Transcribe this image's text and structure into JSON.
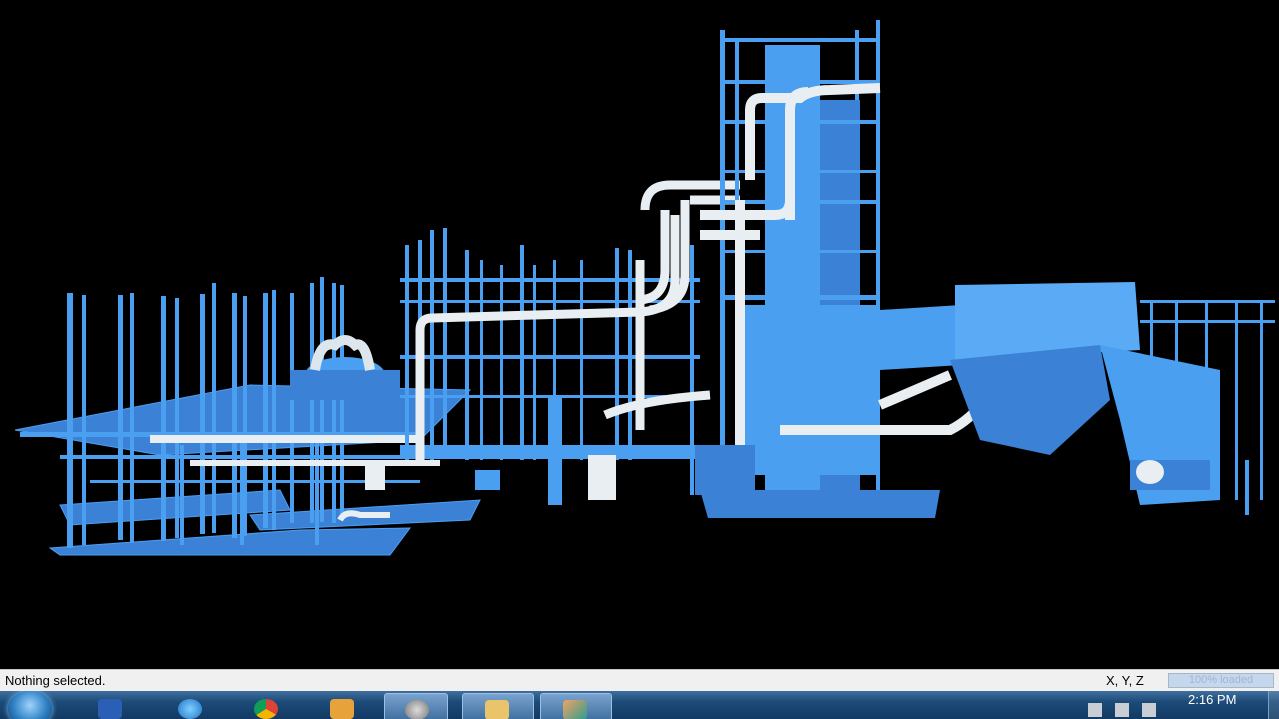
{
  "status": {
    "selection_text": "Nothing selected.",
    "coordinates_label": "X, Y, Z",
    "load_text": "100% loaded",
    "load_percent": 100
  },
  "taskbar": {
    "clock_time": "2:16 PM",
    "apps": [
      {
        "name": "start-button",
        "icon": "windows-logo-icon"
      },
      {
        "name": "info-app",
        "icon": "info-icon"
      },
      {
        "name": "internet-explorer",
        "icon": "internet-explorer-icon"
      },
      {
        "name": "chrome",
        "icon": "chrome-icon"
      },
      {
        "name": "media-player",
        "icon": "media-player-icon"
      },
      {
        "name": "3d-viewer",
        "icon": "viewer-app-icon"
      },
      {
        "name": "file-explorer",
        "icon": "folder-icon"
      },
      {
        "name": "paint",
        "icon": "paint-icon"
      }
    ]
  },
  "colors": {
    "model_blue": "#4a9ff0",
    "model_blue_dark": "#3b82d6",
    "pipe": "#e8eef2",
    "background": "#000000"
  }
}
